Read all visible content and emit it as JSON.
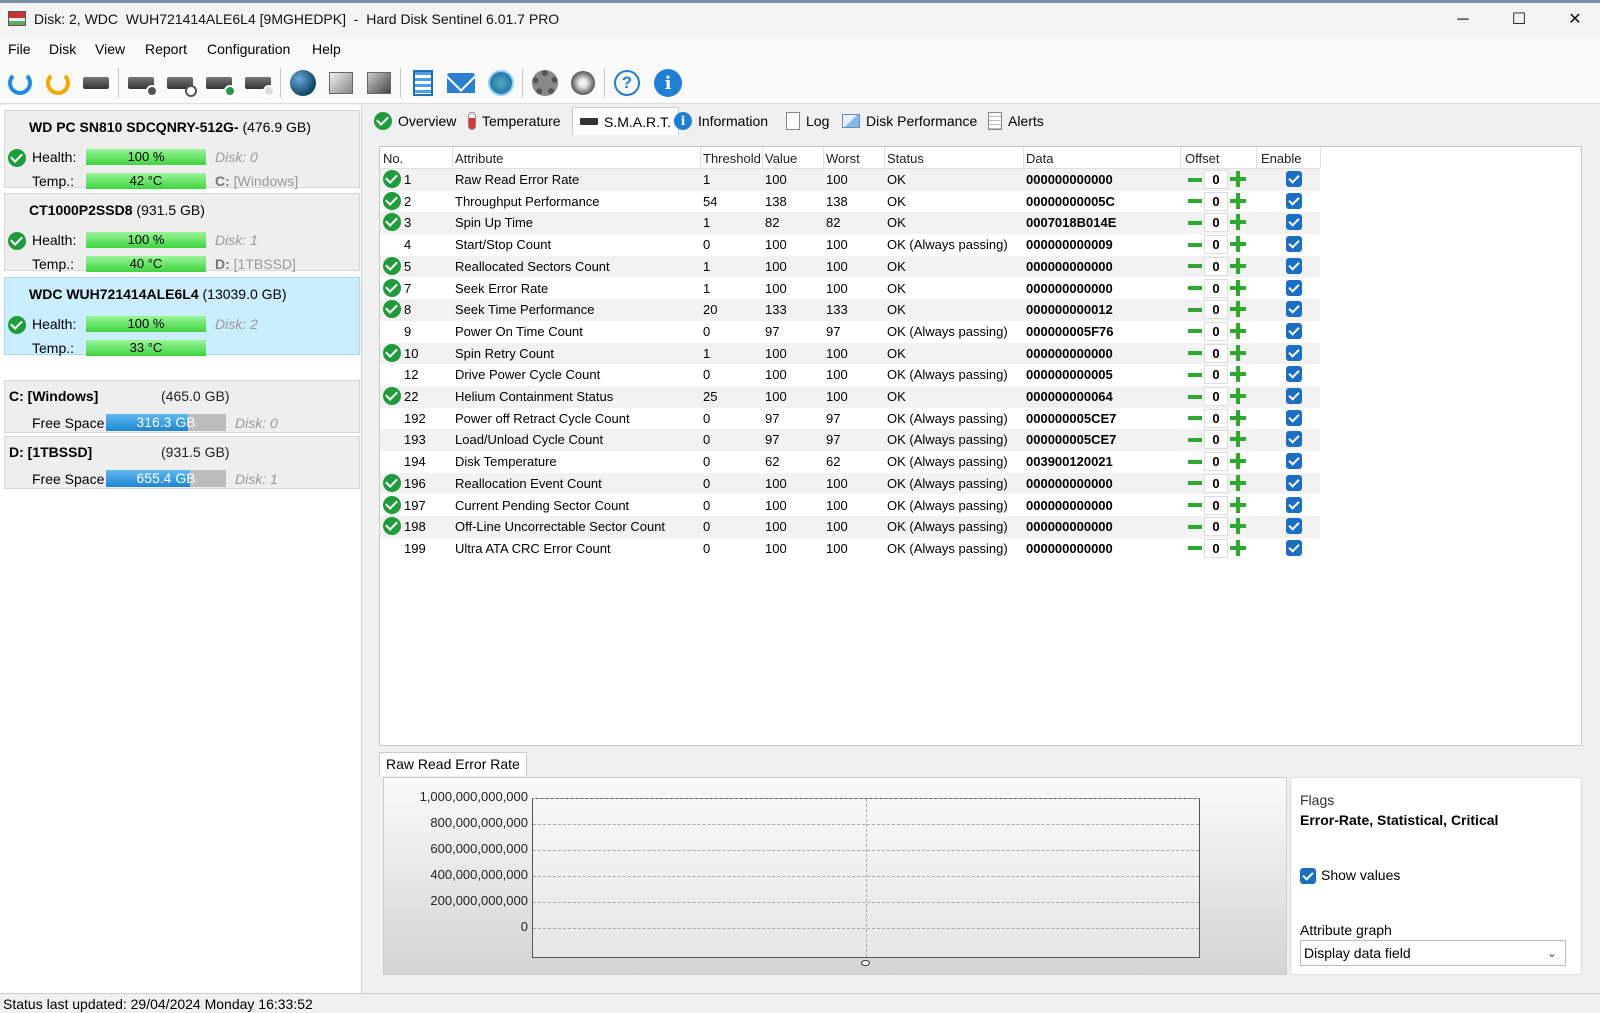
{
  "window": {
    "title": "Disk: 2, WDC  WUH721414ALE6L4 [9MGHEDPK]  -  Hard Disk Sentinel 6.01.7 PRO",
    "minimize": "─",
    "maximize": "☐",
    "close": "✕"
  },
  "menu": [
    "File",
    "Disk",
    "View",
    "Report",
    "Configuration",
    "Help"
  ],
  "toolbar": {
    "icons": [
      "refresh-icon",
      "refresh-warning-icon",
      "disk-list-icon",
      "disk-test-icon",
      "disk-schedule-icon",
      "disk-ok-icon",
      "disk-search-icon",
      "network-globe-icon",
      "server-icon",
      "server-alt-icon",
      "notes-icon",
      "mail-icon",
      "network-icon",
      "settings-gear-icon",
      "sound-icon",
      "help-icon",
      "info-icon"
    ],
    "help_glyph": "?",
    "info_glyph": "i"
  },
  "disks": [
    {
      "name": "WD PC SN810 SDCQNRY-512G-",
      "size": "(476.9 GB)",
      "health_label": "Health:",
      "health": "100 %",
      "health_pct": 100,
      "disk_label": "Disk: 0",
      "temp_label": "Temp.:",
      "temp": "42 °C",
      "volume_letter": "C:",
      "volume_name": "[Windows]"
    },
    {
      "name": "CT1000P2SSD8",
      "size": "(931.5 GB)",
      "health_label": "Health:",
      "health": "100 %",
      "health_pct": 100,
      "disk_label": "Disk: 1",
      "temp_label": "Temp.:",
      "temp": "40 °C",
      "volume_letter": "D:",
      "volume_name": "[1TBSSD]"
    },
    {
      "name": "WDC  WUH721414ALE6L4",
      "size": "(13039.0 GB)",
      "health_label": "Health:",
      "health": "100 %",
      "health_pct": 100,
      "disk_label": "Disk: 2",
      "temp_label": "Temp.:",
      "temp": "33 °C",
      "volume_letter": "",
      "volume_name": ""
    }
  ],
  "partitions": [
    {
      "name": "C: [Windows]",
      "size": "(465.0 GB)",
      "free_label": "Free Space",
      "free": "316.3 GB",
      "free_fraction": 0.68,
      "disk": "Disk: 0"
    },
    {
      "name": "D: [1TBSSD]",
      "size": "(931.5 GB)",
      "free_label": "Free Space",
      "free": "655.4 GB",
      "free_fraction": 0.7,
      "disk": "Disk: 1"
    }
  ],
  "tabs": [
    "Overview",
    "Temperature",
    "S.M.A.R.T.",
    "Information",
    "Log",
    "Disk Performance",
    "Alerts"
  ],
  "active_tab": "S.M.A.R.T.",
  "smart": {
    "columns": [
      "No.",
      "Attribute",
      "Threshold",
      "Value",
      "Worst",
      "Status",
      "Data",
      "Offset",
      "Enable"
    ],
    "rows": [
      {
        "check": true,
        "no": "1",
        "attr": "Raw Read Error Rate",
        "thr": "1",
        "val": "100",
        "worst": "100",
        "status": "OK",
        "data": "000000000000",
        "offset": "0"
      },
      {
        "check": true,
        "no": "2",
        "attr": "Throughput Performance",
        "thr": "54",
        "val": "138",
        "worst": "138",
        "status": "OK",
        "data": "00000000005C",
        "offset": "0"
      },
      {
        "check": true,
        "no": "3",
        "attr": "Spin Up Time",
        "thr": "1",
        "val": "82",
        "worst": "82",
        "status": "OK",
        "data": "0007018B014E",
        "offset": "0"
      },
      {
        "check": false,
        "no": "4",
        "attr": "Start/Stop Count",
        "thr": "0",
        "val": "100",
        "worst": "100",
        "status": "OK (Always passing)",
        "data": "000000000009",
        "offset": "0"
      },
      {
        "check": true,
        "no": "5",
        "attr": "Reallocated Sectors Count",
        "thr": "1",
        "val": "100",
        "worst": "100",
        "status": "OK",
        "data": "000000000000",
        "offset": "0"
      },
      {
        "check": true,
        "no": "7",
        "attr": "Seek Error Rate",
        "thr": "1",
        "val": "100",
        "worst": "100",
        "status": "OK",
        "data": "000000000000",
        "offset": "0"
      },
      {
        "check": true,
        "no": "8",
        "attr": "Seek Time Performance",
        "thr": "20",
        "val": "133",
        "worst": "133",
        "status": "OK",
        "data": "000000000012",
        "offset": "0"
      },
      {
        "check": false,
        "no": "9",
        "attr": "Power On Time Count",
        "thr": "0",
        "val": "97",
        "worst": "97",
        "status": "OK (Always passing)",
        "data": "000000005F76",
        "offset": "0"
      },
      {
        "check": true,
        "no": "10",
        "attr": "Spin Retry Count",
        "thr": "1",
        "val": "100",
        "worst": "100",
        "status": "OK",
        "data": "000000000000",
        "offset": "0"
      },
      {
        "check": false,
        "no": "12",
        "attr": "Drive Power Cycle Count",
        "thr": "0",
        "val": "100",
        "worst": "100",
        "status": "OK (Always passing)",
        "data": "000000000005",
        "offset": "0"
      },
      {
        "check": true,
        "no": "22",
        "attr": "Helium Containment Status",
        "thr": "25",
        "val": "100",
        "worst": "100",
        "status": "OK",
        "data": "000000000064",
        "offset": "0"
      },
      {
        "check": false,
        "no": "192",
        "attr": "Power off Retract Cycle Count",
        "thr": "0",
        "val": "97",
        "worst": "97",
        "status": "OK (Always passing)",
        "data": "000000005CE7",
        "offset": "0"
      },
      {
        "check": false,
        "no": "193",
        "attr": "Load/Unload Cycle Count",
        "thr": "0",
        "val": "97",
        "worst": "97",
        "status": "OK (Always passing)",
        "data": "000000005CE7",
        "offset": "0"
      },
      {
        "check": false,
        "no": "194",
        "attr": "Disk Temperature",
        "thr": "0",
        "val": "62",
        "worst": "62",
        "status": "OK (Always passing)",
        "data": "003900120021",
        "offset": "0"
      },
      {
        "check": true,
        "no": "196",
        "attr": "Reallocation Event Count",
        "thr": "0",
        "val": "100",
        "worst": "100",
        "status": "OK (Always passing)",
        "data": "000000000000",
        "offset": "0"
      },
      {
        "check": true,
        "no": "197",
        "attr": "Current Pending Sector Count",
        "thr": "0",
        "val": "100",
        "worst": "100",
        "status": "OK (Always passing)",
        "data": "000000000000",
        "offset": "0"
      },
      {
        "check": true,
        "no": "198",
        "attr": "Off-Line Uncorrectable Sector Count",
        "thr": "0",
        "val": "100",
        "worst": "100",
        "status": "OK (Always passing)",
        "data": "000000000000",
        "offset": "0"
      },
      {
        "check": false,
        "no": "199",
        "attr": "Ultra ATA CRC Error Count",
        "thr": "0",
        "val": "100",
        "worst": "100",
        "status": "OK (Always passing)",
        "data": "000000000000",
        "offset": "0"
      }
    ]
  },
  "graph": {
    "tab_label": "Raw Read Error Rate",
    "yticks": [
      "1,000,000,000,000",
      "800,000,000,000",
      "600,000,000,000",
      "400,000,000,000",
      "200,000,000,000",
      "0"
    ],
    "point_value": 0
  },
  "properties": {
    "flags_label": "Flags",
    "flags_value": "Error-Rate, Statistical, Critical",
    "show_values_label": "Show values",
    "show_values_checked": true,
    "attribute_graph_label": "Attribute graph",
    "attribute_graph_value": "Display data field",
    "chevron": "⌄"
  },
  "status": "Status last updated: 29/04/2024 Monday 16:33:52",
  "colors": {
    "health_bar": "#3fd43f",
    "ok_check": "#1e9c3c",
    "selected_disk": "#cbeeff",
    "free_bar": "#1d86cf",
    "offset_buttons": "#2ea82e",
    "checkbox": "#1a6fc4"
  }
}
